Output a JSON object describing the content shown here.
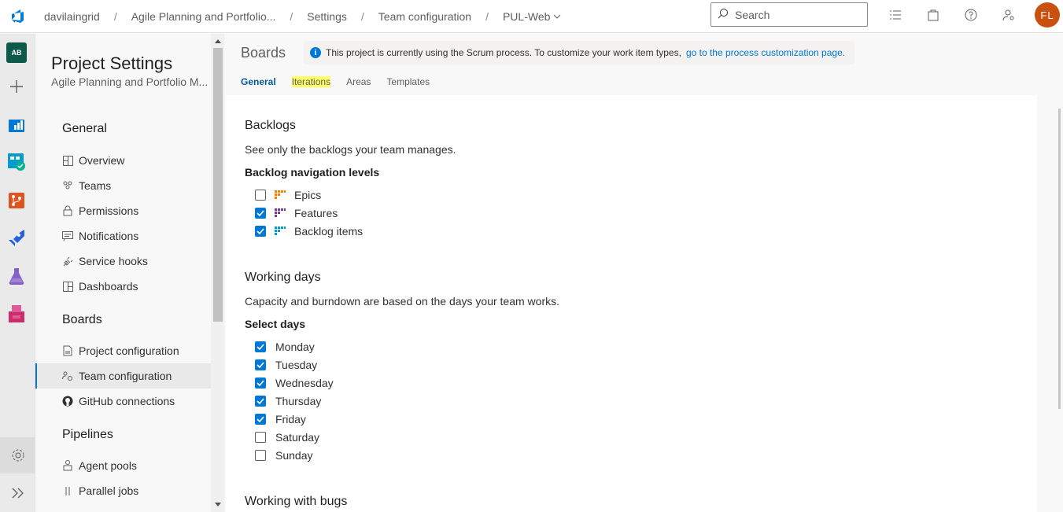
{
  "breadcrumb": {
    "items": [
      "davilaingrid",
      "Agile Planning and Portfolio...",
      "Settings",
      "Team configuration",
      "PUL-Web"
    ]
  },
  "search": {
    "placeholder": "Search"
  },
  "user": {
    "initials": "FL",
    "color": "#ca5010"
  },
  "rail": {
    "org_initials": "AB"
  },
  "sidebar": {
    "title": "Project Settings",
    "subtitle": "Agile Planning and Portfolio M...",
    "sections": [
      {
        "label": "General",
        "items": [
          "Overview",
          "Teams",
          "Permissions",
          "Notifications",
          "Service hooks",
          "Dashboards"
        ]
      },
      {
        "label": "Boards",
        "items": [
          "Project configuration",
          "Team configuration",
          "GitHub connections"
        ]
      },
      {
        "label": "Pipelines",
        "items": [
          "Agent pools",
          "Parallel jobs"
        ]
      }
    ],
    "selected": "Team configuration"
  },
  "main": {
    "title": "Boards",
    "info_text": "This project is currently using the Scrum process. To customize your work item types,",
    "info_link": "go to the process customization page.",
    "tabs": [
      "General",
      "Iterations",
      "Areas",
      "Templates"
    ],
    "active_tab": "General"
  },
  "backlogs": {
    "heading": "Backlogs",
    "description": "See only the backlogs your team manages.",
    "subheading": "Backlog navigation levels",
    "levels": [
      {
        "label": "Epics",
        "checked": false,
        "color": "#ff7b00"
      },
      {
        "label": "Features",
        "checked": true,
        "color": "#773b93"
      },
      {
        "label": "Backlog items",
        "checked": true,
        "color": "#009ccc"
      }
    ]
  },
  "working_days": {
    "heading": "Working days",
    "description": "Capacity and burndown are based on the days your team works.",
    "subheading": "Select days",
    "days": [
      {
        "label": "Monday",
        "checked": true
      },
      {
        "label": "Tuesday",
        "checked": true
      },
      {
        "label": "Wednesday",
        "checked": true
      },
      {
        "label": "Thursday",
        "checked": true
      },
      {
        "label": "Friday",
        "checked": true
      },
      {
        "label": "Saturday",
        "checked": false
      },
      {
        "label": "Sunday",
        "checked": false
      }
    ]
  },
  "bugs": {
    "heading": "Working with bugs"
  },
  "colors": {
    "accent": "#0078d4",
    "highlight": "#ffff66"
  }
}
